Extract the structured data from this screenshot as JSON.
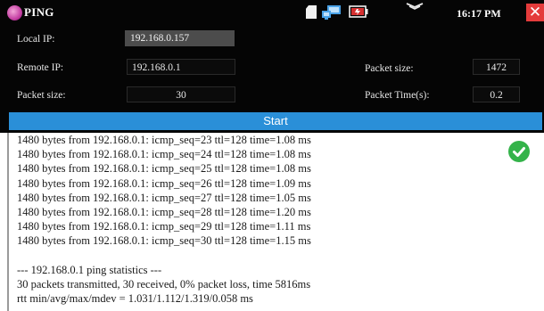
{
  "titlebar": {
    "logo_text": "",
    "title": "PING",
    "clock": "16:17 PM",
    "close_glyph": "✕",
    "icons": [
      "sd-card-icon",
      "network-icon",
      "battery-icon",
      "signal-icon",
      "close-icon"
    ],
    "colors": {
      "background": "#050505",
      "close": "#e43b3b"
    }
  },
  "settings": {
    "local_ip": {
      "label": "Local IP:",
      "value": "192.168.0.157"
    },
    "remote_ip": {
      "label": "Remote IP:",
      "value": "192.168.0.1"
    },
    "packet_size_left": {
      "label": "Packet size:",
      "value": "30"
    },
    "packet_size_right": {
      "label": "Packet size:",
      "value": "1472"
    },
    "packet_time": {
      "label": "Packet Time(s):",
      "value": "0.2"
    }
  },
  "start_button": {
    "label": "Start",
    "color": "#2a8fd8"
  },
  "output": {
    "lines": [
      "1480 bytes from 192.168.0.1: icmp_seq=23 ttl=128 time=1.08 ms",
      "1480 bytes from 192.168.0.1: icmp_seq=24 ttl=128 time=1.08 ms",
      "1480 bytes from 192.168.0.1: icmp_seq=25 ttl=128 time=1.08 ms",
      "1480 bytes from 192.168.0.1: icmp_seq=26 ttl=128 time=1.09 ms",
      "1480 bytes from 192.168.0.1: icmp_seq=27 ttl=128 time=1.05 ms",
      "1480 bytes from 192.168.0.1: icmp_seq=28 ttl=128 time=1.20 ms",
      "1480 bytes from 192.168.0.1: icmp_seq=29 ttl=128 time=1.11 ms",
      "1480 bytes from 192.168.0.1: icmp_seq=30 ttl=128 time=1.15 ms",
      "",
      "--- 192.168.0.1 ping statistics ---",
      "30 packets transmitted, 30 received, 0% packet loss, time 5816ms",
      "rtt min/avg/max/mdev = 1.031/1.112/1.319/0.058 ms"
    ],
    "status_icon": "check-circle-icon",
    "status_color": "#34b34a"
  }
}
